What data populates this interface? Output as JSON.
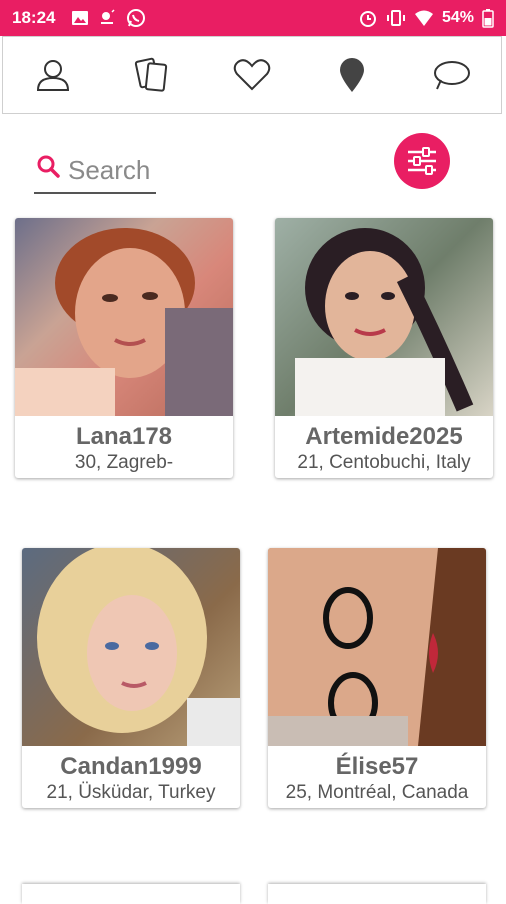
{
  "status_bar": {
    "time": "18:24",
    "battery": "54%",
    "left_icons": [
      "image-icon",
      "weather-icon",
      "whatsapp-icon"
    ],
    "right_icons": [
      "alarm-icon",
      "vibrate-icon",
      "wifi-icon",
      "battery-icon"
    ]
  },
  "nav": {
    "items": [
      "profile-icon",
      "cards-icon",
      "heart-icon",
      "location-pin-icon",
      "chat-icon"
    ]
  },
  "search": {
    "placeholder": "Search"
  },
  "colors": {
    "accent": "#e91e63",
    "text": "#666666"
  },
  "profiles": [
    {
      "name": "Lana178",
      "info": "30, Zagreb-"
    },
    {
      "name": "Artemide2025",
      "info": "21, Centobuchi, Italy"
    },
    {
      "name": "Candan1999",
      "info": "21, Üsküdar, Turkey"
    },
    {
      "name": "Élise57",
      "info": "25, Montréal, Canada"
    }
  ]
}
